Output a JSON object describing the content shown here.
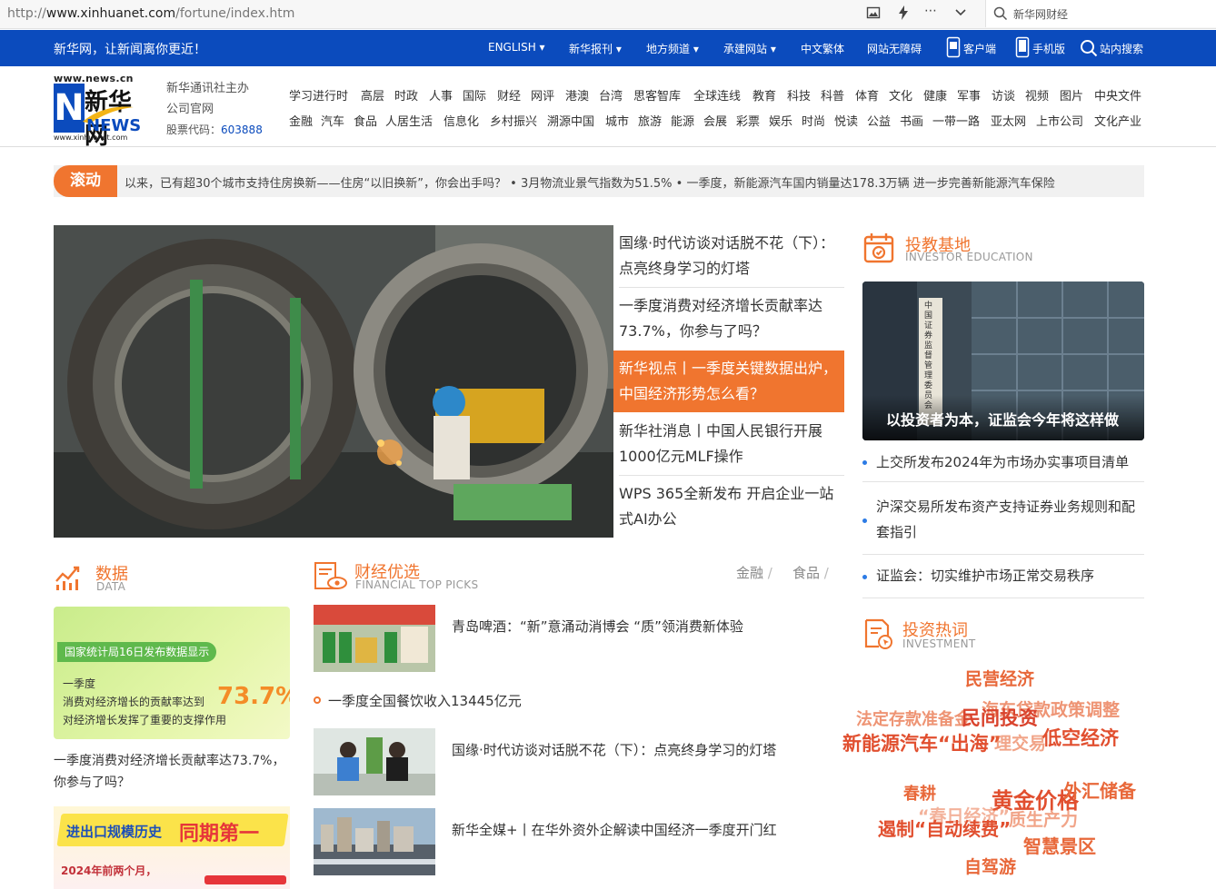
{
  "browser": {
    "url_prefix": "http://",
    "url_host": "www.xinhuanet.com",
    "url_path": "/fortune/index.htm",
    "search_text": "新华网财经"
  },
  "topnav": {
    "slogan": "新华网，让新闻离你更近！",
    "items": [
      "ENGLISH",
      "新华报刊",
      "地方频道",
      "承建网站",
      "中文繁体",
      "网站无障碍",
      "客户端",
      "手机版",
      "站内搜索"
    ]
  },
  "header": {
    "logo_domain": "www.news.cn",
    "logo_cn": "新华网",
    "logo_en": "NEWS",
    "logo_url": "www.xinhuanet.com",
    "org_line1": "新华通讯社主办",
    "org_line2": "公司官网",
    "stock_label": "股票代码：",
    "stock_code": "603888",
    "channels_row1": [
      "学习进行时",
      "高层",
      "时政",
      "人事",
      "国际",
      "财经",
      "网评",
      "港澳",
      "台湾",
      "思客智库",
      "全球连线",
      "教育",
      "科技",
      "科普",
      "体育",
      "文化",
      "健康",
      "军事",
      "访谈",
      "视频",
      "图片",
      "中央文件"
    ],
    "channels_row2": [
      "金融",
      "汽车",
      "食品",
      "人居生活",
      "信息化",
      "乡村振兴",
      "溯源中国",
      "城市",
      "旅游",
      "能源",
      "会展",
      "彩票",
      "娱乐",
      "时尚",
      "悦读",
      "公益",
      "书画",
      "一带一路",
      "亚太网",
      "上市公司",
      "文化产业"
    ]
  },
  "ticker": {
    "label": "滚动",
    "text": "以来，已有超30个城市支持住房换新——住房“以旧换新”，你会出手吗？   •  3月物流业景气指数为51.5%   •  一季度，新能源汽车国内销量达178.3万辆 进一步完善新能源汽车保险"
  },
  "headlines": [
    "国缘·时代访谈对话脱不花（下）：点亮终身学习的灯塔",
    "一季度消费对经济增长贡献率达73.7%，你参与了吗？",
    "新华视点丨一季度关键数据出炉，中国经济形势怎么看？",
    "新华社消息丨中国人民银行开展1000亿元MLF操作",
    "WPS 365全新发布 开启企业一站式AI办公"
  ],
  "data_section": {
    "title": "数据",
    "subtitle": "DATA",
    "box_tag": "国家统计局16日发布数据显示",
    "box_line1": "一季度",
    "box_line2": "消费对经济增长的贡献率达到",
    "box_line3": "对经济增长发挥了重要的支撑作用",
    "box_big": "73.7%",
    "caption": "一季度消费对经济增长贡献率达73.7%，你参与了吗？",
    "banner_title_a": "进出口规模历史",
    "banner_title_b": "同期第一",
    "banner_sub": "2024年前两个月，"
  },
  "picks": {
    "title": "财经优选",
    "subtitle": "FINANCIAL TOP PICKS",
    "tabs": [
      "金融",
      "食品"
    ],
    "items": [
      "青岛啤酒：“新”意涌动消博会 “质”领消费新体验",
      "一季度全国餐饮收入13445亿元",
      "国缘·时代访谈对话脱不花（下）：点亮终身学习的灯塔",
      "新华全媒+丨在华外资外企解读中国经济一季度开门红"
    ]
  },
  "invest_edu": {
    "title": "投教基地",
    "subtitle": "INVESTOR EDUCATION",
    "img_caption": "以投资者为本，证监会今年将这样做",
    "sign_text": "中国证券监督管理委员会",
    "links": [
      "上交所发布2024年为市场办实事项目清单",
      "沪深交易所发布资产支持证券业务规则和配套指引",
      "证监会：切实维护市场正常交易秩序"
    ]
  },
  "invest_hot": {
    "title": "投资热词",
    "subtitle": "INVESTMENT",
    "words": [
      "民营经济",
      "法定存款准备金",
      "海东贷款政策调整",
      "民间投资",
      "新能源汽车“出海”",
      "理交易",
      "低空经济",
      "春耕",
      "黄金价格",
      "外汇储备",
      "“春日经济”",
      "质生产力",
      "遏制“自动续费”",
      "智慧景区",
      "自驾游"
    ]
  },
  "colors": {
    "brand_blue": "#0b4bbd",
    "accent_orange": "#f0752f"
  }
}
